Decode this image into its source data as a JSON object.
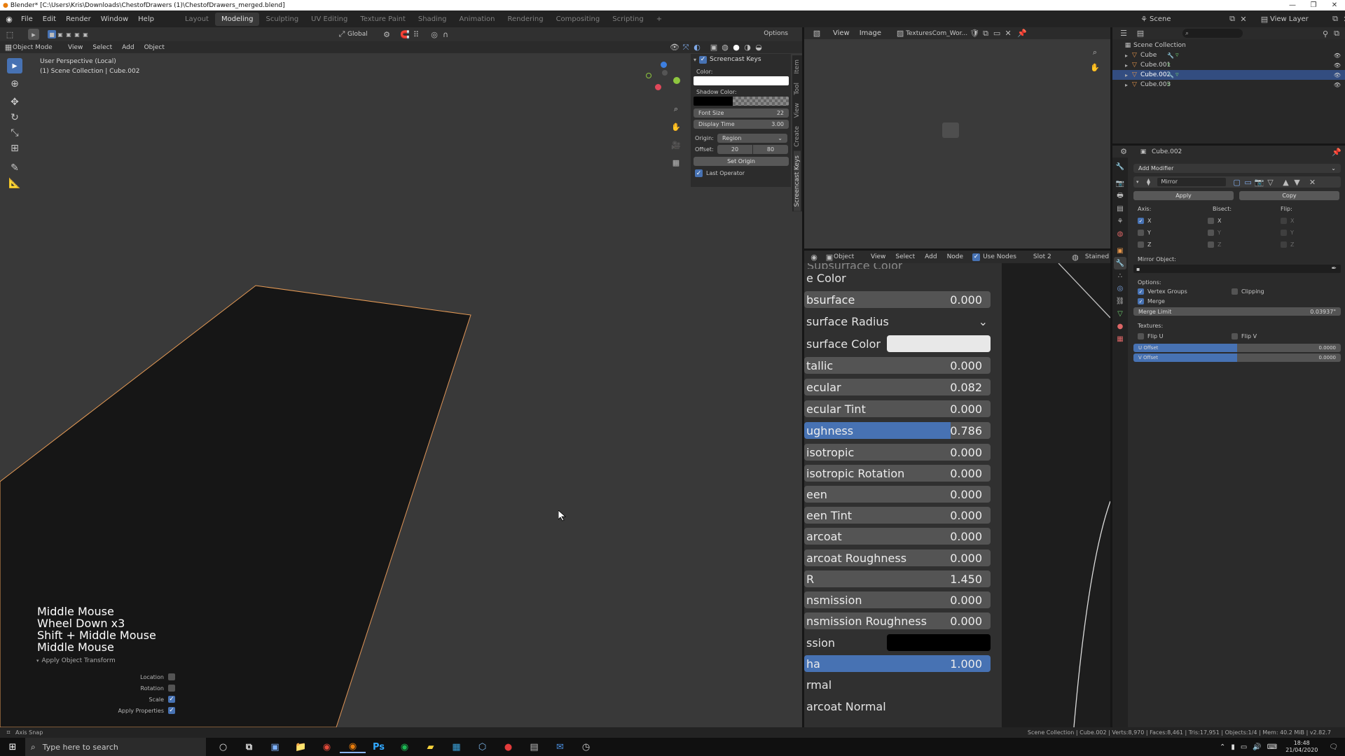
{
  "titlebar": {
    "title": "Blender* [C:\\Users\\Kris\\Downloads\\ChestofDrawers (1)\\ChestofDrawers_merged.blend]"
  },
  "topbar": {
    "menus": [
      "File",
      "Edit",
      "Render",
      "Window",
      "Help"
    ],
    "workspaces": [
      "Layout",
      "Modeling",
      "Sculpting",
      "UV Editing",
      "Texture Paint",
      "Shading",
      "Animation",
      "Rendering",
      "Compositing",
      "Scripting"
    ],
    "active_workspace": "Modeling",
    "add_tab": "+",
    "scene_label": "Scene",
    "view_layer_label": "View Layer"
  },
  "viewport": {
    "mode": "Object Mode",
    "menus": [
      "View",
      "Select",
      "Add",
      "Object"
    ],
    "transform_orientation": "Global",
    "options_label": "Options",
    "perspective_label": "User Perspective (Local)",
    "collection_label": "(1) Scene Collection | Cube.002",
    "keys_shown": [
      "Middle Mouse",
      "Wheel Down x3",
      "Shift + Middle Mouse",
      "Middle Mouse"
    ],
    "operator_panel": {
      "title": "Apply Object Transform",
      "items": [
        {
          "label": "Location",
          "checked": false
        },
        {
          "label": "Rotation",
          "checked": false
        },
        {
          "label": "Scale",
          "checked": true
        },
        {
          "label": "Apply Properties",
          "checked": true
        }
      ]
    }
  },
  "screencast_panel": {
    "title": "Screencast Keys",
    "color_label": "Color:",
    "shadow_label": "Shadow Color:",
    "font_size_label": "Font Size",
    "font_size_value": "22",
    "display_time_label": "Display Time",
    "display_time_value": "3.00",
    "origin_label": "Origin:",
    "origin_value": "Region",
    "offset_label": "Offset:",
    "offset_x": "20",
    "offset_y": "80",
    "set_origin_label": "Set Origin",
    "last_operator_label": "Last Operator",
    "side_tabs": [
      "Item",
      "Tool",
      "View",
      "Create",
      "Screencast Keys"
    ]
  },
  "image_editor": {
    "menus": [
      "View",
      "Image"
    ],
    "image_name": "TexturesCom_Wor..."
  },
  "node_editor": {
    "object_label": "Object",
    "menus": [
      "View",
      "Select",
      "Add",
      "Node"
    ],
    "use_nodes_label": "Use Nodes",
    "slot_label": "Slot 2",
    "material_label": "Stained",
    "header_cut": "Subsurface Color",
    "fields": [
      {
        "label": "e Color",
        "kind": "header"
      },
      {
        "label": "bsurface",
        "value": "0.000",
        "kind": "num"
      },
      {
        "label": "surface Radius",
        "kind": "dropdown"
      },
      {
        "label": "surface Color",
        "kind": "color",
        "color": "#e8e8e8"
      },
      {
        "label": "tallic",
        "value": "0.000",
        "kind": "num"
      },
      {
        "label": "ecular",
        "value": "0.082",
        "kind": "num"
      },
      {
        "label": "ecular Tint",
        "value": "0.000",
        "kind": "num"
      },
      {
        "label": "ughness",
        "value": "0.786",
        "kind": "num",
        "fill": 0.786
      },
      {
        "label": "isotropic",
        "value": "0.000",
        "kind": "num"
      },
      {
        "label": "isotropic Rotation",
        "value": "0.000",
        "kind": "num"
      },
      {
        "label": "een",
        "value": "0.000",
        "kind": "num"
      },
      {
        "label": "een Tint",
        "value": "0.000",
        "kind": "num"
      },
      {
        "label": "arcoat",
        "value": "0.000",
        "kind": "num"
      },
      {
        "label": "arcoat Roughness",
        "value": "0.000",
        "kind": "num"
      },
      {
        "label": "R",
        "value": "1.450",
        "kind": "num"
      },
      {
        "label": "nsmission",
        "value": "0.000",
        "kind": "num"
      },
      {
        "label": "nsmission Roughness",
        "value": "0.000",
        "kind": "num"
      },
      {
        "label": "ssion",
        "kind": "color",
        "color": "#000000"
      },
      {
        "label": "ha",
        "value": "1.000",
        "kind": "num",
        "fill": 1.0
      },
      {
        "label": "rmal",
        "kind": "header"
      },
      {
        "label": "arcoat Normal",
        "kind": "header"
      }
    ]
  },
  "outliner": {
    "root": "Scene Collection",
    "items": [
      {
        "name": "Cube",
        "selected": false
      },
      {
        "name": "Cube.001",
        "selected": false
      },
      {
        "name": "Cube.002",
        "selected": true
      },
      {
        "name": "Cube.003",
        "selected": false
      }
    ]
  },
  "properties": {
    "object_name": "Cube.002",
    "add_modifier_label": "Add Modifier",
    "modifier_name": "Mirror",
    "apply_label": "Apply",
    "copy_label": "Copy",
    "axis_label": "Axis:",
    "bisect_label": "Bisect:",
    "flip_label": "Flip:",
    "axes": [
      "X",
      "Y",
      "Z"
    ],
    "axis_checked": [
      true,
      false,
      false
    ],
    "mirror_object_label": "Mirror Object:",
    "options_label": "Options:",
    "vertex_groups_label": "Vertex Groups",
    "clipping_label": "Clipping",
    "merge_label": "Merge",
    "merge_limit_label": "Merge Limit",
    "merge_limit_value": "0.03937\"",
    "textures_label": "Textures:",
    "flip_u_label": "Flip U",
    "flip_v_label": "Flip V",
    "u_offset_label": "U Offset",
    "u_offset_value": "0.0000",
    "v_offset_label": "V Offset",
    "v_offset_value": "0.0000"
  },
  "statusbar": {
    "left": "Axis Snap",
    "right": "Scene Collection | Cube.002 | Verts:8,970 | Faces:8,461 | Tris:17,951 | Objects:1/4 | Mem: 40.2 MiB | v2.82.7"
  },
  "taskbar": {
    "search_placeholder": "Type here to search",
    "time": "18:48",
    "date": "21/04/2020"
  },
  "colors": {
    "accent": "#4772b3",
    "selection_outline": "#e59a55",
    "outliner_selected": "#334d80"
  }
}
